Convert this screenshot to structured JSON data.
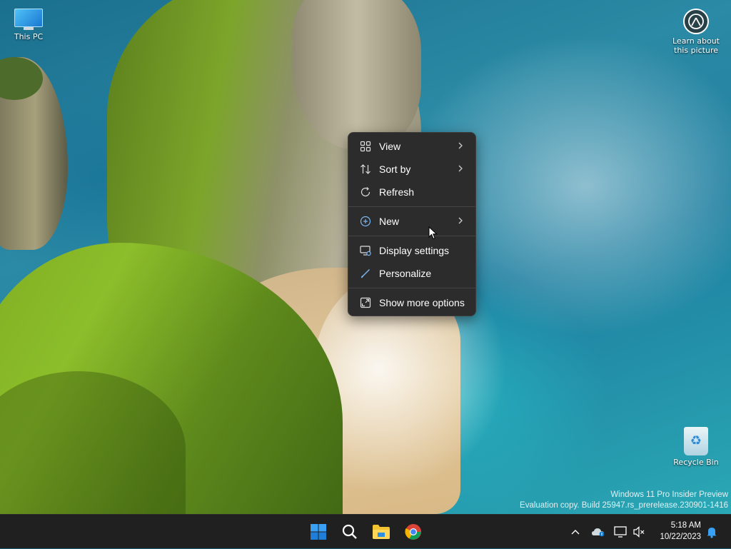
{
  "desktop": {
    "this_pc": "This PC",
    "learn_line1": "Learn about",
    "learn_line2": "this picture",
    "recycle_bin": "Recycle Bin",
    "watermark_line1": "Windows 11 Pro Insider Preview",
    "watermark_line2": "Evaluation copy. Build 25947.rs_prerelease.230901-1416"
  },
  "context_menu": {
    "items": [
      {
        "label": "View",
        "icon": "grid-icon",
        "submenu": true
      },
      {
        "label": "Sort by",
        "icon": "sort-icon",
        "submenu": true
      },
      {
        "label": "Refresh",
        "icon": "refresh-icon",
        "submenu": false
      },
      {
        "label": "New",
        "icon": "plus-circle-icon",
        "submenu": true
      },
      {
        "label": "Display settings",
        "icon": "display-settings-icon",
        "submenu": false
      },
      {
        "label": "Personalize",
        "icon": "brush-icon",
        "submenu": false
      },
      {
        "label": "Show more options",
        "icon": "expand-icon",
        "submenu": false
      }
    ]
  },
  "taskbar": {
    "apps": [
      "start-icon",
      "search-icon",
      "file-explorer-icon",
      "chrome-icon"
    ],
    "tray_icons": [
      "chevron-up-icon",
      "onedrive-icon",
      "network-icon",
      "volume-muted-icon"
    ],
    "time": "5:18 AM",
    "date": "10/22/2023",
    "notification_icon": "bell-icon"
  },
  "colors": {
    "menu_bg": "#2c2c2c",
    "taskbar_bg": "#202020",
    "accent": "#0078d4"
  }
}
